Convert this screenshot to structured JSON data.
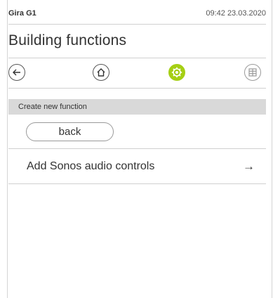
{
  "status": {
    "device_name": "Gira G1",
    "datetime": "09:42 23.03.2020"
  },
  "page": {
    "title": "Building functions"
  },
  "nav": {
    "back_icon": "←",
    "home_icon": "⌂",
    "settings_icon": "gear-icon",
    "rooms_icon": "grid-icon",
    "active_color": "#a5cf14"
  },
  "section": {
    "header": "Create new function"
  },
  "controls": {
    "back_label": "back"
  },
  "list": {
    "items": [
      {
        "label": "Add Sonos audio controls",
        "arrow": "→"
      }
    ]
  }
}
